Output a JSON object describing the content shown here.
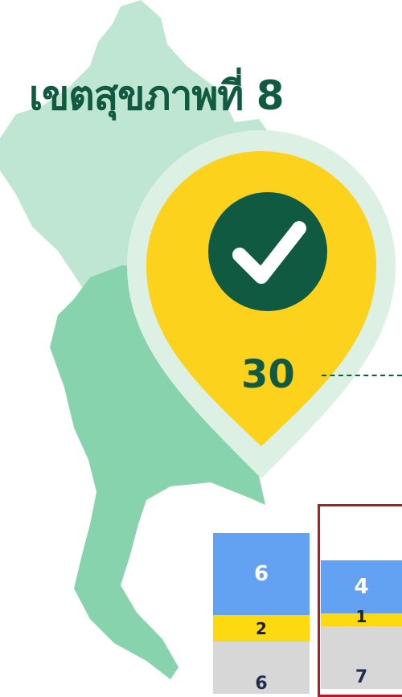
{
  "title": "เขตสุขภาพที่ 8",
  "pin": {
    "count": "30",
    "icon": "check-icon",
    "colors": {
      "pin": "#fcd21c",
      "halo": "#dcf1e4",
      "badge": "#0f5a40"
    }
  },
  "map": {
    "colors": {
      "north": "#bfe6d2",
      "south": "#87d3ad"
    }
  },
  "bars": [
    {
      "top": "6",
      "middle": "2",
      "bottom": "6"
    },
    {
      "top": "4",
      "middle": "1",
      "bottom": "7"
    }
  ],
  "colors": {
    "blue": "#63a2f3",
    "yellow": "#fdd90f",
    "gray": "#d7d7d7",
    "frame": "#b01e23"
  }
}
